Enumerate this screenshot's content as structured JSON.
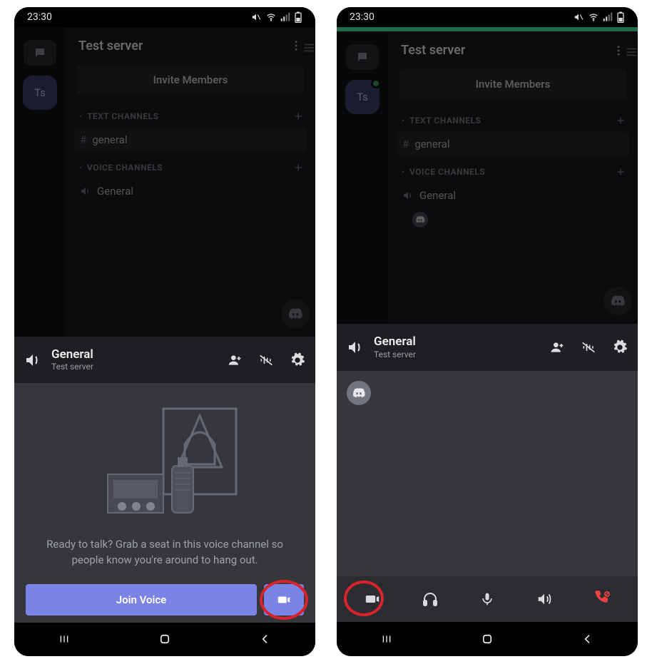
{
  "status": {
    "time": "23:30"
  },
  "server": {
    "name": "Test server",
    "avatar_initials": "Ts",
    "invite_label": "Invite Members",
    "text_channels_label": "TEXT CHANNELS",
    "voice_channels_label": "VOICE CHANNELS",
    "text_channels": [
      {
        "name": "general"
      }
    ],
    "voice_channels": [
      {
        "name": "General"
      }
    ]
  },
  "voice_header": {
    "channel": "General",
    "server": "Test server"
  },
  "lobby": {
    "text": "Ready to talk? Grab a seat in this voice channel so people know you're around to hang out.",
    "join_label": "Join Voice"
  }
}
